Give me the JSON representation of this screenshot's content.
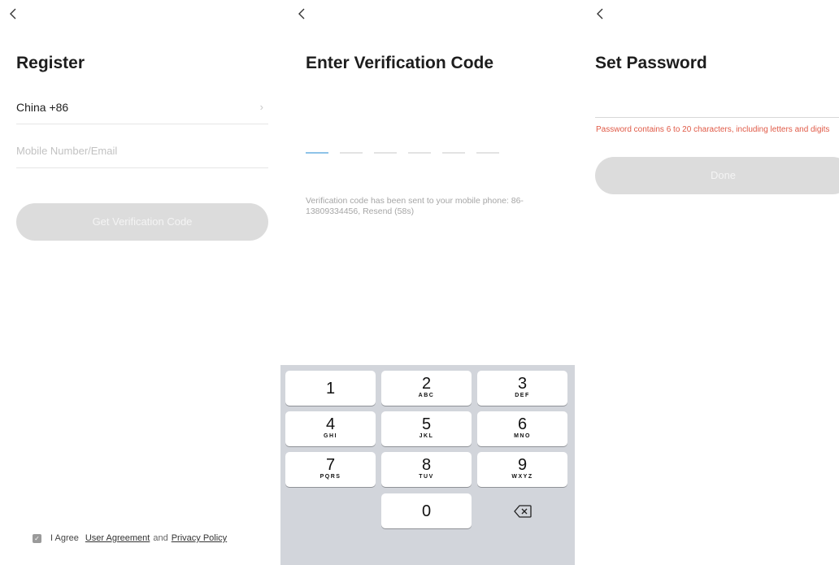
{
  "register": {
    "title": "Register",
    "country": "China +86",
    "country_chevron": "›",
    "mobile_placeholder": "Mobile Number/Email",
    "get_code_label": "Get Verification Code",
    "agree_prefix": "I Agree",
    "user_agreement": "User Agreement",
    "and_text": "and",
    "privacy_policy": "Privacy Policy"
  },
  "verify": {
    "title": "Enter Verification Code",
    "code_slots": 6,
    "sent_message": "Verification code has been sent to your mobile phone: 86-13809334456, Resend (58s)",
    "keys": [
      {
        "num": "1",
        "letters": ""
      },
      {
        "num": "2",
        "letters": "ABC"
      },
      {
        "num": "3",
        "letters": "DEF"
      },
      {
        "num": "4",
        "letters": "GHI"
      },
      {
        "num": "5",
        "letters": "JKL"
      },
      {
        "num": "6",
        "letters": "MNO"
      },
      {
        "num": "7",
        "letters": "PQRS"
      },
      {
        "num": "8",
        "letters": "TUV"
      },
      {
        "num": "9",
        "letters": "WXYZ"
      },
      {
        "num": "0",
        "letters": ""
      }
    ]
  },
  "password": {
    "title": "Set Password",
    "hint": "Password contains 6 to 20 characters, including letters and digits",
    "done_label": "Done"
  },
  "colors": {
    "disabled_button": "#dcdcdc",
    "hint_red": "#e05a47",
    "active_slot": "#8ec3e8",
    "keypad_bg": "#d2d5db"
  },
  "icons": [
    "back-chevron-icon",
    "checkbox-icon",
    "delete-key-icon"
  ]
}
